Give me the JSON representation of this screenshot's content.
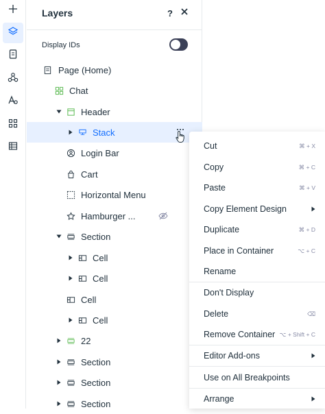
{
  "panel": {
    "title": "Layers",
    "help_label": "?",
    "display_ids_label": "Display IDs"
  },
  "toolbar": {
    "items": [
      {
        "icon": "plus-icon"
      },
      {
        "icon": "layers-icon"
      },
      {
        "icon": "pages-icon"
      },
      {
        "icon": "connections-icon"
      },
      {
        "icon": "theme-icon"
      },
      {
        "icon": "apps-icon"
      },
      {
        "icon": "table-icon"
      }
    ]
  },
  "tree": [
    {
      "label": "Page (Home)",
      "icon": "page-icon"
    },
    {
      "label": "Chat",
      "icon": "chat-widget-icon"
    },
    {
      "label": "Header",
      "icon": "header-icon"
    },
    {
      "label": "Stack",
      "icon": "stack-icon"
    },
    {
      "label": "Login Bar",
      "icon": "user-icon"
    },
    {
      "label": "Cart",
      "icon": "bag-icon"
    },
    {
      "label": "Horizontal Menu",
      "icon": "dashed-box-icon"
    },
    {
      "label": "Hamburger ...",
      "icon": "star-icon"
    },
    {
      "label": "Section",
      "icon": "section-icon"
    },
    {
      "label": "Cell",
      "icon": "cell-icon"
    },
    {
      "label": "Cell",
      "icon": "cell-icon"
    },
    {
      "label": "Cell",
      "icon": "cell-icon"
    },
    {
      "label": "Cell",
      "icon": "cell-icon"
    },
    {
      "label": "22",
      "icon": "section-green-icon"
    },
    {
      "label": "Section",
      "icon": "section-icon"
    },
    {
      "label": "Section",
      "icon": "section-icon"
    },
    {
      "label": "Section",
      "icon": "section-icon"
    }
  ],
  "context_menu": {
    "items": [
      {
        "label": "Cut",
        "shortcut": "⌘ + X"
      },
      {
        "label": "Copy",
        "shortcut": "⌘ + C"
      },
      {
        "label": "Paste",
        "shortcut": "⌘ + V"
      },
      {
        "label": "Copy Element Design",
        "shortcut": ""
      },
      {
        "label": "Duplicate",
        "shortcut": "⌘ + D"
      },
      {
        "label": "Place in Container",
        "shortcut": "⌥ + C"
      },
      {
        "label": "Rename",
        "shortcut": ""
      },
      {
        "label": "Don't Display",
        "shortcut": ""
      },
      {
        "label": "Delete",
        "shortcut": "⌫"
      },
      {
        "label": "Remove Container",
        "shortcut": "⌥ + Shift + C"
      },
      {
        "label": "Editor Add-ons",
        "shortcut": ""
      },
      {
        "label": "Use on All Breakpoints",
        "shortcut": ""
      },
      {
        "label": "Arrange",
        "shortcut": ""
      }
    ]
  },
  "colors": {
    "accent": "#116dff",
    "selected_bg": "#e7f0ff",
    "green": "#60bc57",
    "text": "#20303c",
    "muted": "#868aa5"
  }
}
